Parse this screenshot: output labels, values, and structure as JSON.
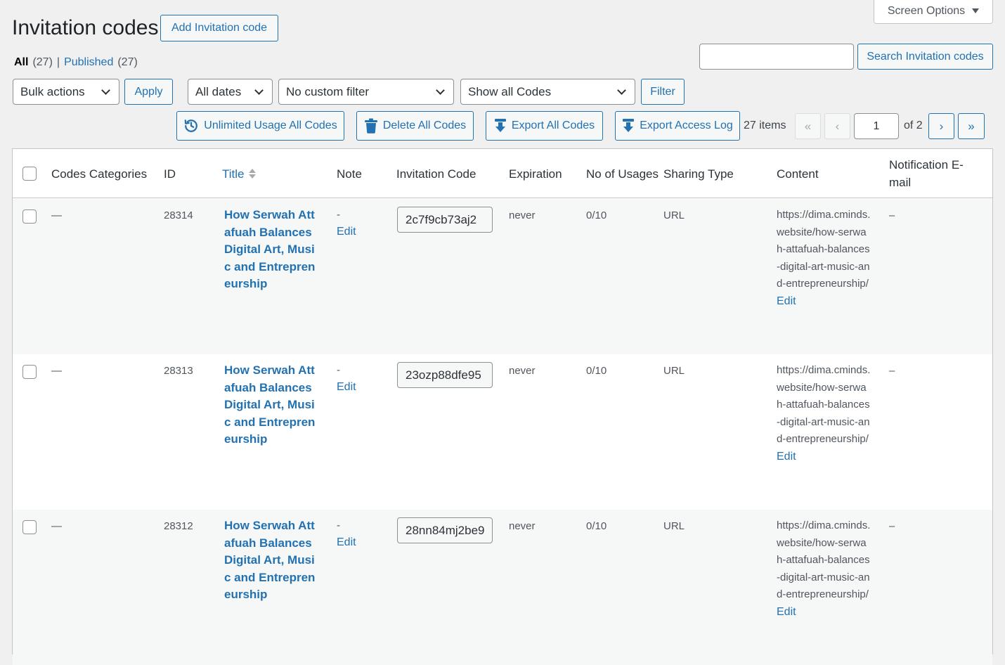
{
  "header": {
    "title": "Invitation codes",
    "add_button": "Add Invitation code",
    "screen_options": "Screen Options"
  },
  "views": {
    "all_label": "All",
    "all_count": "(27)",
    "separator": "|",
    "published_label": "Published",
    "published_count": "(27)"
  },
  "search": {
    "value": "",
    "button": "Search Invitation codes"
  },
  "filters": {
    "bulk_actions": "Bulk actions",
    "apply": "Apply",
    "dates": "All dates",
    "custom_filter": "No custom filter",
    "show_codes": "Show all Codes",
    "filter_button": "Filter"
  },
  "actions": {
    "unlimited": "Unlimited Usage All Codes",
    "delete_all": "Delete All Codes",
    "export_all": "Export All Codes",
    "export_log": "Export Access Log"
  },
  "pagination": {
    "items": "27 items",
    "first": "«",
    "prev": "‹",
    "current": "1",
    "of": "of 2",
    "next": "›",
    "last": "»"
  },
  "table": {
    "columns": {
      "categories": "Codes Categories",
      "id": "ID",
      "title": "Title",
      "note": "Note",
      "code": "Invitation Code",
      "expiration": "Expiration",
      "usages": "No of Usages",
      "sharing": "Sharing Type",
      "content": "Content",
      "notification": "Notification E-mail"
    },
    "rows": [
      {
        "category": "—",
        "id": "28314",
        "title": "How Serwah Attafuah Balances Digital Art, Music and Entrepreneurship",
        "note": "-",
        "note_edit": "Edit",
        "code": "2c7f9cb73aj2",
        "expiration": "never",
        "usages": "0/10",
        "sharing": "URL",
        "content": "https://dima.cminds.website/how-serwah-attafuah-balances-digital-art-music-and-entrepreneurship/",
        "content_edit": "Edit",
        "notification": "–"
      },
      {
        "category": "—",
        "id": "28313",
        "title": "How Serwah Attafuah Balances Digital Art, Music and Entrepreneurship",
        "note": "-",
        "note_edit": "Edit",
        "code": "23ozp88dfe95",
        "expiration": "never",
        "usages": "0/10",
        "sharing": "URL",
        "content": "https://dima.cminds.website/how-serwah-attafuah-balances-digital-art-music-and-entrepreneurship/",
        "content_edit": "Edit",
        "notification": "–"
      },
      {
        "category": "—",
        "id": "28312",
        "title": "How Serwah Attafuah Balances Digital Art, Music and Entrepreneurship",
        "note": "-",
        "note_edit": "Edit",
        "code": "28nn84mj2be9",
        "expiration": "never",
        "usages": "0/10",
        "sharing": "URL",
        "content": "https://dima.cminds.website/how-serwah-attafuah-balances-digital-art-music-and-entrepreneurship/",
        "content_edit": "Edit",
        "notification": "–"
      }
    ]
  }
}
